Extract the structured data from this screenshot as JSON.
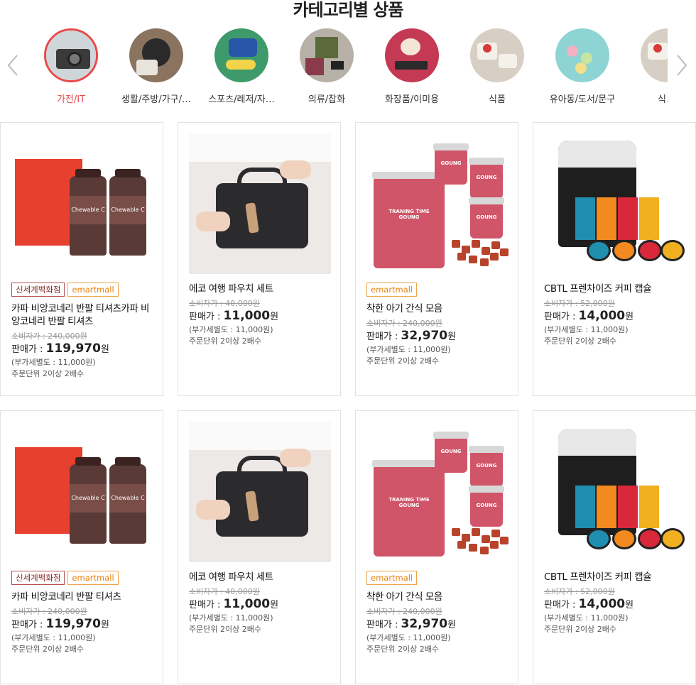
{
  "section_title": "카테고리별 상품",
  "categories": [
    {
      "label": "가전/IT",
      "icon": "camera-icon",
      "active": true
    },
    {
      "label": "생활/주방/가구/…",
      "icon": "pan-icon",
      "active": false
    },
    {
      "label": "스포츠/레저/자…",
      "icon": "sports-icon",
      "active": false
    },
    {
      "label": "의류/잡화",
      "icon": "clothing-icon",
      "active": false
    },
    {
      "label": "화장품/이미용",
      "icon": "cosmetics-icon",
      "active": false
    },
    {
      "label": "식품",
      "icon": "food-icon",
      "active": false
    },
    {
      "label": "유아동/도서/문구",
      "icon": "kids-icon",
      "active": false
    },
    {
      "label": "식",
      "icon": "food-icon",
      "active": false
    }
  ],
  "colors": {
    "accent": "#e84a4a",
    "emart": "#e8820e",
    "shinsegae": "#8a2b2b"
  },
  "products": [
    {
      "badges": [
        "신세계백화점",
        "emartmall"
      ],
      "name": "카파 비앙코네리 반팔 티셔츠카파 비앙코네리 반팔 티셔츠",
      "orig_price": "소비자가 : 240,000원",
      "sale_label": "판매가 : ",
      "sale_price": "119,970",
      "won": "원",
      "vat": "(부가세별도 : 11,000원)",
      "unit": "주문단위 2이상 2배수",
      "image": "supplement"
    },
    {
      "badges": [],
      "name": "에코 여행 파우치 세트",
      "orig_price": "소비자가 : 40,000원",
      "sale_label": "판매가 : ",
      "sale_price": "11,000",
      "won": "원",
      "vat": "(부가세별도 : 11,000원)",
      "unit": "주문단위 2이상 2배수",
      "image": "pouch"
    },
    {
      "badges": [
        "emartmall"
      ],
      "name": "착한 아기 간식 모음",
      "orig_price": "소비자가 : 240,000원",
      "sale_label": "판매가 : ",
      "sale_price": "32,970",
      "won": "원",
      "vat": "(부가세별도 : 11,000원)",
      "unit": "주문단위 2이상 2배수",
      "image": "treats"
    },
    {
      "badges": [],
      "name": "CBTL 프렌차이즈 커피 캡슐",
      "orig_price": "소비자가 : 52,000원",
      "sale_label": "판매가 : ",
      "sale_price": "14,000",
      "won": "원",
      "vat": "(부가세별도 : 11,000원)",
      "unit": "주문단위 2이상 2배수",
      "image": "coffee"
    },
    {
      "badges": [
        "신세계백화점",
        "emartmall"
      ],
      "name": "카파 비앙코네리 반팔 티셔츠",
      "orig_price": "소비자가 : 240,000원",
      "sale_label": "판매가 : ",
      "sale_price": "119,970",
      "won": "원",
      "vat": "(부가세별도 : 11,000원)",
      "unit": "주문단위 2이상 2배수",
      "image": "supplement"
    },
    {
      "badges": [],
      "name": "에코 여행 파우치 세트",
      "orig_price": "소비자가 : 40,000원",
      "sale_label": "판매가 : ",
      "sale_price": "11,000",
      "won": "원",
      "vat": "(부가세별도 : 11,000원)",
      "unit": "주문단위 2이상 2배수",
      "image": "pouch"
    },
    {
      "badges": [
        "emartmall"
      ],
      "name": "착한 아기 간식 모음",
      "orig_price": "소비자가 : 240,000원",
      "sale_label": "판매가 : ",
      "sale_price": "32,970",
      "won": "원",
      "vat": "(부가세별도 : 11,000원)",
      "unit": "주문단위 2이상 2배수",
      "image": "treats"
    },
    {
      "badges": [],
      "name": "CBTL 프렌차이즈 커피 캡슐",
      "orig_price": "소비자가 : 52,000원",
      "sale_label": "판매가 : ",
      "sale_price": "14,000",
      "won": "원",
      "vat": "(부가세별도 : 11,000원)",
      "unit": "주문단위 2이상 2배수",
      "image": "coffee"
    }
  ]
}
